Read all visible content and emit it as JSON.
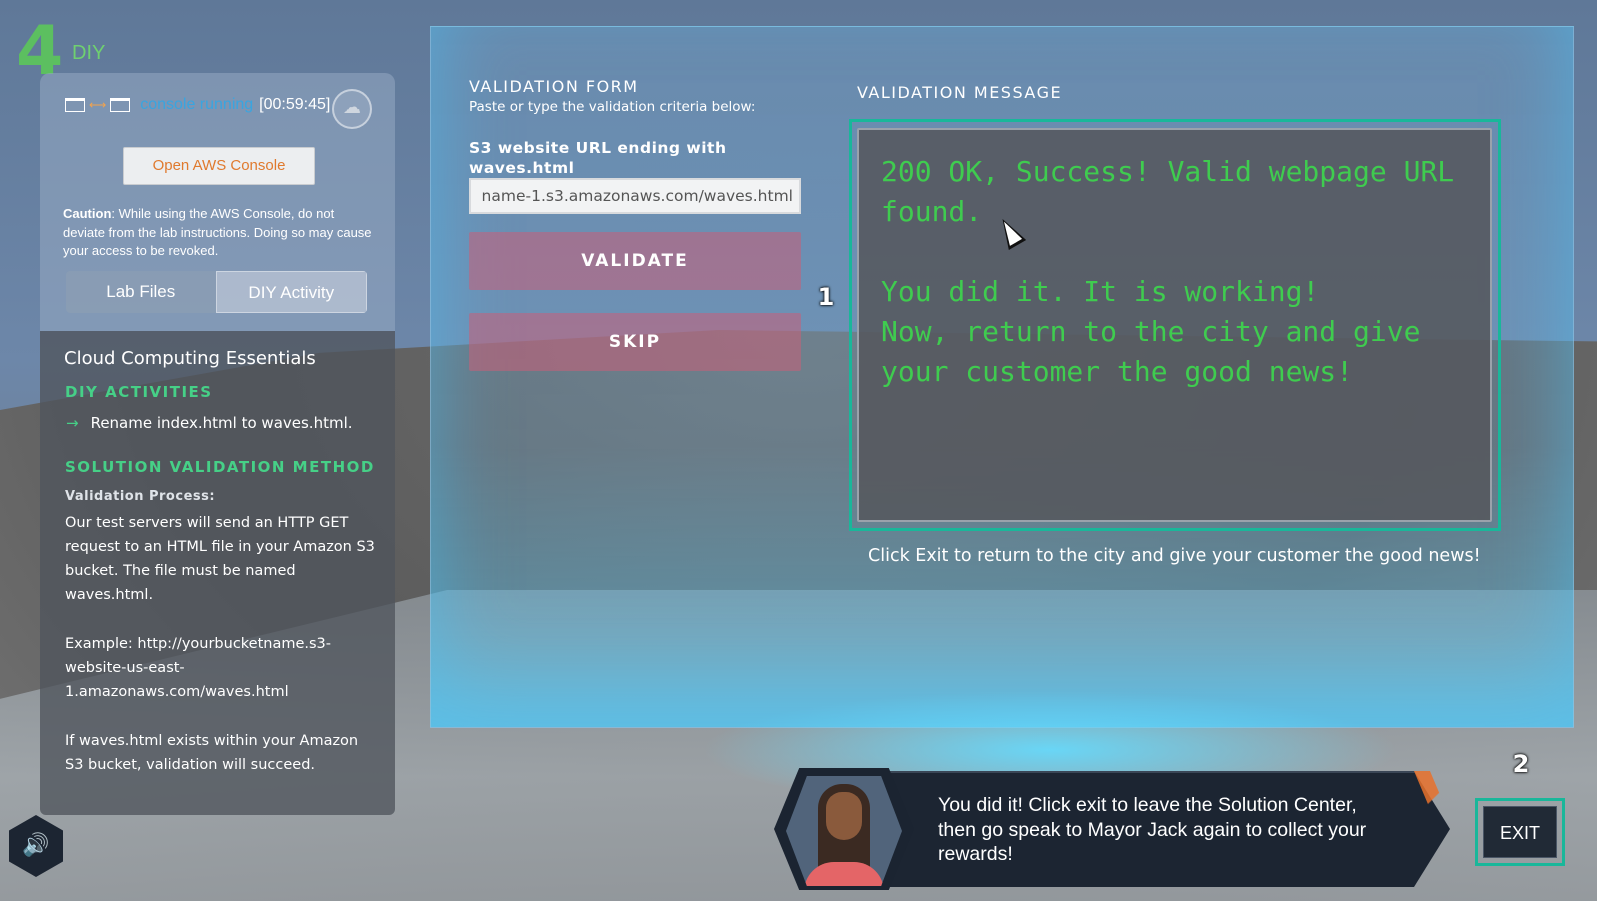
{
  "step": {
    "number": "4",
    "label": "DIY"
  },
  "console": {
    "status": "console running",
    "timer": "[00:59:45]",
    "cloud_icon": "cloud-icon"
  },
  "open_console_label": "Open AWS Console",
  "caution": {
    "label": "Caution",
    "text": ": While using the AWS Console, do not deviate from the lab instructions. Doing so may cause your access to be revoked."
  },
  "tabs": [
    {
      "label": "Lab Files"
    },
    {
      "label": "DIY Activity"
    }
  ],
  "panel": {
    "course_title": "Cloud Computing Essentials",
    "activities_heading": "DIY ACTIVITIES",
    "activity_item": "Rename index.html to waves.html.",
    "validation_heading": "SOLUTION VALIDATION METHOD",
    "process_label": "Validation Process:",
    "process_text": "Our test servers will send an HTTP GET request to an HTML file in your Amazon S3 bucket. The file must be named waves.html.",
    "example_text": "Example: http://yourbucketname.s3-website-us-east-1.amazonaws.com/waves.html",
    "success_text": "If waves.html exists within your Amazon S3 bucket, validation will succeed."
  },
  "form": {
    "title": "VALIDATION FORM",
    "subtitle": "Paste or type the validation criteria below:",
    "field_label": "S3 website URL ending with waves.html",
    "url_value": "name-1.s3.amazonaws.com/waves.html",
    "validate_label": "VALIDATE",
    "skip_label": "SKIP"
  },
  "badges": {
    "one": "1",
    "two": "2"
  },
  "message": {
    "title": "VALIDATION MESSAGE",
    "line1": "200 OK, Success! Valid webpage URL found.",
    "line2": "You did it. It is working!",
    "line3": "Now, return to the city and give your customer the good news!",
    "hint": "Click Exit to return to the city and give your customer the good news!"
  },
  "dialog": {
    "text": "You did it! Click exit to leave the Solution Center, then go speak to Mayor Jack again to collect your rewards!"
  },
  "exit_label": "EXIT",
  "colors": {
    "accent_green": "#3fcc4f",
    "teal": "#19b79a",
    "orange": "#e07a2e"
  }
}
